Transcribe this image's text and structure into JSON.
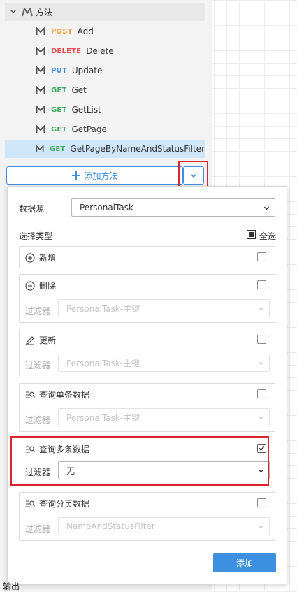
{
  "tree": {
    "group_label": "方法",
    "items": [
      {
        "method": "POST",
        "label": "Add",
        "cls": "post"
      },
      {
        "method": "DELETE",
        "label": "Delete",
        "cls": "delete"
      },
      {
        "method": "PUT",
        "label": "Update",
        "cls": "put"
      },
      {
        "method": "GET",
        "label": "Get",
        "cls": "get"
      },
      {
        "method": "GET",
        "label": "GetList",
        "cls": "get"
      },
      {
        "method": "GET",
        "label": "GetPage",
        "cls": "get"
      },
      {
        "method": "GET",
        "label": "GetPageByNameAndStatusFilter",
        "cls": "get",
        "selected": true
      }
    ]
  },
  "add_method": {
    "label": "添加方法"
  },
  "popup": {
    "datasource_label": "数据源",
    "datasource_value": "PersonalTask",
    "select_type_label": "选择类型",
    "select_all_label": "全选",
    "filter_label": "过滤器",
    "cards": {
      "add": {
        "title": "新增",
        "checked": false
      },
      "delete": {
        "title": "删除",
        "checked": false,
        "filter_value": "PersonalTask-主键"
      },
      "update": {
        "title": "更新",
        "checked": false,
        "filter_value": "PersonalTask-主键"
      },
      "query_single": {
        "title": "查询单条数据",
        "checked": false,
        "filter_value": "PersonalTask-主键"
      },
      "query_multi": {
        "title": "查询多条数据",
        "checked": true,
        "filter_value": "无"
      },
      "query_page": {
        "title": "查询分页数据",
        "checked": false,
        "filter_value": "NameAndStatusFilter"
      }
    },
    "add_button": "添加"
  },
  "bottom_label": "输出",
  "colors": {
    "accent": "#3d8fe0",
    "highlight": "#d9252b",
    "get": "#3eaa62",
    "post": "#f0a040",
    "delete": "#e5484d",
    "put": "#3d8fe0"
  }
}
